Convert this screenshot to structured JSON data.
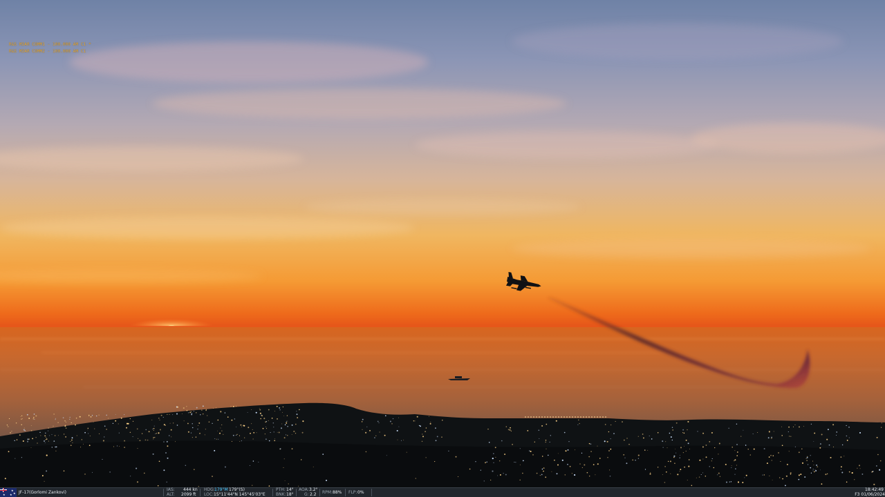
{
  "radio": {
    "lines": [
      "R&S M3AR COMM1 - 100.000 AM C1 *",
      "R&S M3AR COMM2 - 100.000 AM C1"
    ]
  },
  "status_bar": {
    "unit": "JF-17(Gorlomi Zankovi)",
    "ias_label": "IAS:",
    "ias_value": "444 kn",
    "alt_label": "ALT:",
    "alt_value": "2099 ft",
    "hdg_label": "HDG:",
    "hdg_value": "179°M",
    "hdg_true": "179°(S)",
    "loc_label": "LOC:",
    "loc_value": "15°11'44\"N 145°45'03\"E",
    "pth_label": "PTH:",
    "pth_value": "14°",
    "bnk_label": "BNK:",
    "bnk_value": "18°",
    "aoa_label": "AOA:",
    "aoa_value": "3.2°",
    "g_label": "G:",
    "g_value": "2.2",
    "rpm_label": "RPM:",
    "rpm_value": "88%",
    "flp_label": "FLP:",
    "flp_value": "0%",
    "time": "18:42:49",
    "date": "F3 01/06/2024"
  },
  "colors": {
    "radio_text": "#f2b23a",
    "status_bg": "#22272d",
    "highlight": "#49c8ff"
  }
}
